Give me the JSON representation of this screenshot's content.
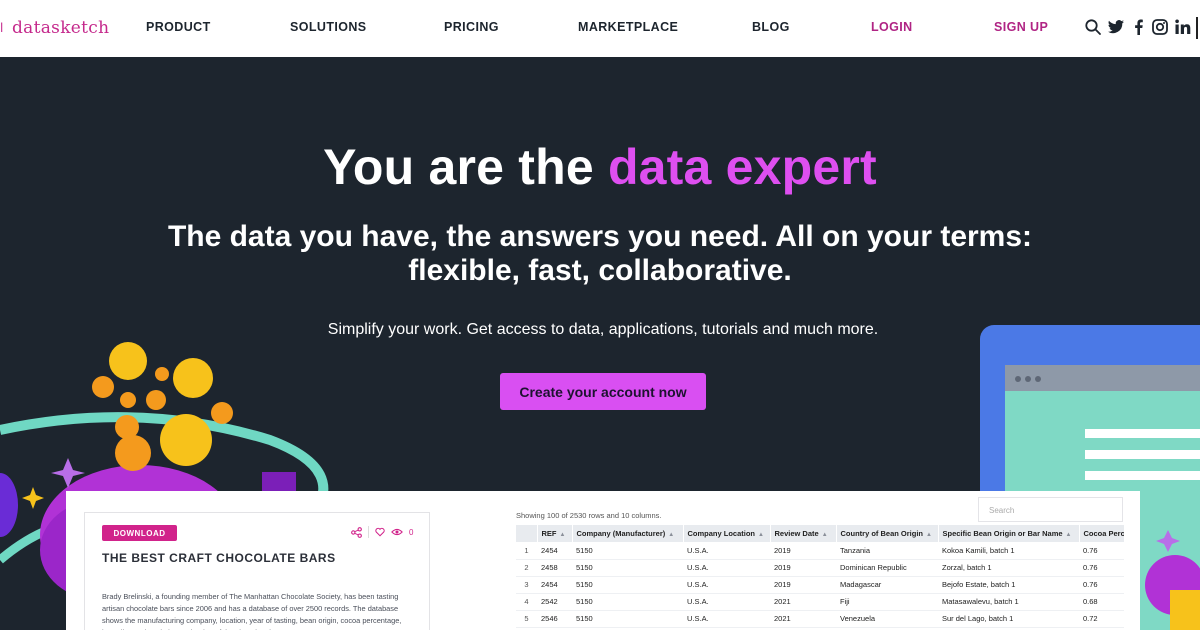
{
  "brand": {
    "logo_text": "datasketch",
    "accent": "#c5298c"
  },
  "nav": {
    "items": [
      {
        "label": "PRODUCT"
      },
      {
        "label": "SOLUTIONS"
      },
      {
        "label": "PRICING"
      },
      {
        "label": "MARKETPLACE"
      },
      {
        "label": "BLOG"
      }
    ],
    "login": "LOGIN",
    "signup": "SIGN UP",
    "icons": [
      "search-icon",
      "twitter-icon",
      "facebook-icon",
      "instagram-icon",
      "linkedin-icon"
    ]
  },
  "hero": {
    "title_plain": "You are the ",
    "title_highlight": "data expert",
    "subtitle_line1": "The data you have, the answers you need. All on your terms:",
    "subtitle_line2": "flexible, fast, collaborative.",
    "description": "Simplify your work. Get access to data, applications, tutorials and much more.",
    "cta": "Create your account now",
    "colors": {
      "background": "#1d252e",
      "highlight": "#de4ff0",
      "cta": "#d94ff2"
    }
  },
  "card": {
    "badge": "DOWNLOAD",
    "title": "THE BEST CRAFT CHOCOLATE BARS",
    "views": "0",
    "text": "Brady Brelinski, a founding member of The Manhattan Chocolate Society, has been tasting artisan chocolate bars since 2006 and has a database of over 2500 records. The database shows the manufacturing company, location, year of tasting, bean origin, cocoa percentage, ingredients, description and rating of the chocolate bars."
  },
  "table": {
    "showing": "Showing 100 of 2530 rows and 10 columns.",
    "search_placeholder": "Search",
    "columns": [
      "REF",
      "Company (Manufacturer)",
      "Company Location",
      "Review Date",
      "Country of Bean Origin",
      "Specific Bean Origin or Bar Name",
      "Cocoa Perc"
    ],
    "rows": [
      {
        "idx": "1",
        "cells": [
          "2454",
          "5150",
          "U.S.A.",
          "2019",
          "Tanzania",
          "Kokoa Kamili, batch 1",
          "0.76"
        ]
      },
      {
        "idx": "2",
        "cells": [
          "2458",
          "5150",
          "U.S.A.",
          "2019",
          "Dominican Republic",
          "Zorzal, batch 1",
          "0.76"
        ]
      },
      {
        "idx": "3",
        "cells": [
          "2454",
          "5150",
          "U.S.A.",
          "2019",
          "Madagascar",
          "Bejofo Estate, batch 1",
          "0.76"
        ]
      },
      {
        "idx": "4",
        "cells": [
          "2542",
          "5150",
          "U.S.A.",
          "2021",
          "Fiji",
          "Matasawalevu, batch 1",
          "0.68"
        ]
      },
      {
        "idx": "5",
        "cells": [
          "2546",
          "5150",
          "U.S.A.",
          "2021",
          "Venezuela",
          "Sur del Lago, batch 1",
          "0.72"
        ]
      }
    ]
  }
}
